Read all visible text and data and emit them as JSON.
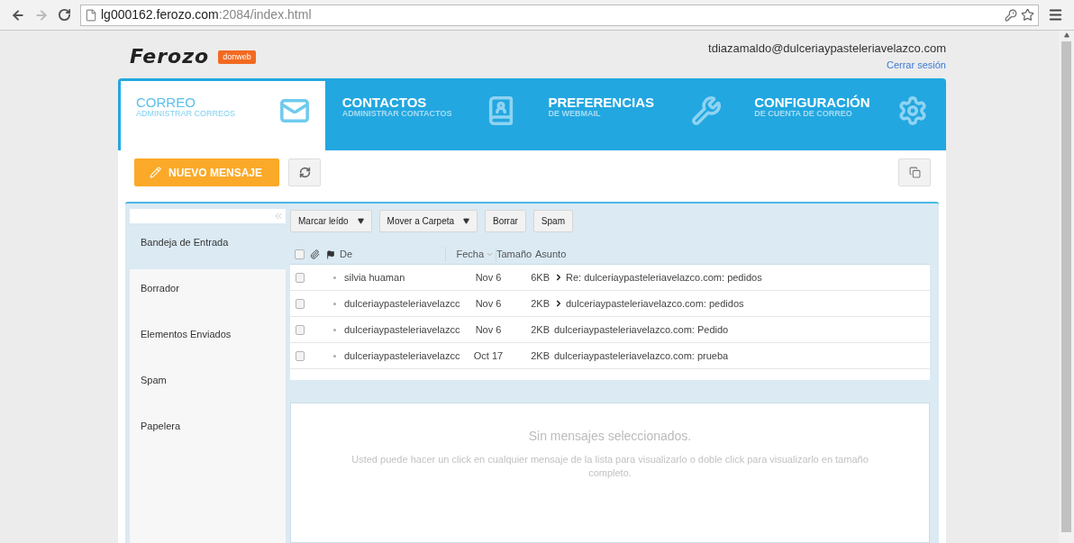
{
  "browser": {
    "url_host": "lg000162.ferozo.com",
    "url_rest": ":2084/index.html"
  },
  "header": {
    "logo": "Ferozo",
    "badge": "donweb",
    "user_email": "tdiazamaldo@dulceriaypasteleriavelazco.com",
    "logout": "Cerrar sesión"
  },
  "tabs": [
    {
      "title": "CORREO",
      "subtitle": "ADMINISTRAR CORREOS",
      "selected": true
    },
    {
      "title": "CONTACTOS",
      "subtitle": "ADMINISTRAR CONTACTOS",
      "selected": false
    },
    {
      "title": "PREFERENCIAS",
      "subtitle": "DE WEBMAIL",
      "selected": false
    },
    {
      "title": "CONFIGURACIÓN",
      "subtitle": "DE CUENTA DE CORREO",
      "selected": false
    }
  ],
  "new_message_button": "NUEVO MENSAJE",
  "folders": [
    {
      "label": "Bandeja de Entrada",
      "selected": true
    },
    {
      "label": "Borrador",
      "selected": false
    },
    {
      "label": "Elementos Enviados",
      "selected": false
    },
    {
      "label": "Spam",
      "selected": false
    },
    {
      "label": "Papelera",
      "selected": false
    }
  ],
  "actions": [
    {
      "label": "Marcar leído",
      "dropdown": true
    },
    {
      "label": "Mover a Carpeta",
      "dropdown": true
    },
    {
      "label": "Borrar",
      "dropdown": false
    },
    {
      "label": "Spam",
      "dropdown": false
    }
  ],
  "select_all_checked": false,
  "columns": [
    {
      "label": "De",
      "sorted": false
    },
    {
      "label": "Fecha",
      "sorted": true
    },
    {
      "label": "Tamaño",
      "sorted": false
    },
    {
      "label": "Asunto",
      "sorted": false
    }
  ],
  "messages": [
    {
      "from": "silvia huaman",
      "date": "Nov 6",
      "size": "6KB",
      "subject": "Re: dulceriaypasteleriavelazco.com: pedidos",
      "thread": true,
      "checked": false
    },
    {
      "from": "dulceriaypasteleriavelazcc",
      "date": "Nov 6",
      "size": "2KB",
      "subject": "dulceriaypasteleriavelazco.com: pedidos",
      "thread": true,
      "checked": false
    },
    {
      "from": "dulceriaypasteleriavelazcc",
      "date": "Nov 6",
      "size": "2KB",
      "subject": "dulceriaypasteleriavelazco.com: Pedido",
      "thread": false,
      "checked": false
    },
    {
      "from": "dulceriaypasteleriavelazcc",
      "date": "Oct 17",
      "size": "2KB",
      "subject": "dulceriaypasteleriavelazco.com: prueba",
      "thread": false,
      "checked": false
    }
  ],
  "preview": {
    "title": "Sin mensajes seleccionados.",
    "text": "Usted puede hacer un click en cualquier mensaje de la lista para visualizarlo o doble click para visualizarlo en tamaño completo."
  }
}
